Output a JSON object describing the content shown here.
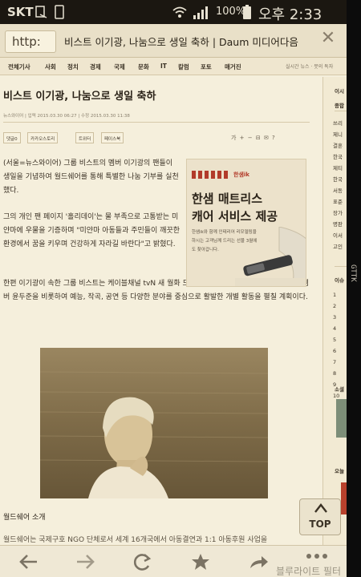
{
  "status_bar": {
    "carrier": "SKT",
    "battery_percent": "100%",
    "clock": "오후 2:33",
    "icons": [
      "wifi-icon",
      "signal-icon",
      "battery-icon",
      "sim-icon",
      "screenshot-icon"
    ]
  },
  "browser": {
    "url_text": "http:",
    "tab_title": "비스트 이기광, 나눔으로 생일 축하 | Daum 미디어다음",
    "close_icon": "close-icon"
  },
  "nav": {
    "items": [
      "전체기사",
      "사회",
      "정치",
      "경제",
      "국제",
      "문화",
      "IT",
      "칼럼",
      "포토",
      "매거진"
    ],
    "right_text": "실시간 뉴스 · 뭇의 독자"
  },
  "article": {
    "headline": "비스트 이기광, 나눔으로 생일 축하",
    "meta": "뉴스와이어  |  입력 2015.03.30 06:27  |  수정 2015.03.30 11:38",
    "share_buttons": [
      "댓글0",
      "카카오스토리",
      "트위터",
      "페이스북"
    ],
    "text_tools": "가 + − ⊟ ✉ ?",
    "paragraphs": [
      "(서울=뉴스와이어) 그룹 비스트의 멤버 이기광의 팬들이 생일을 기념하여 월드쉐어를 통해 특별한 나눔 기부를 실천했다.",
      "그의 개인 팬 페이지 '홀리데이'는 물 부족으로 고통받는 미얀마에 우물을 기증하며 \"미얀마 아동들과 주민들이 깨끗한 환경에서 꿈을 키우며 건강하게 자라길 바란다\"고 밝혔다.",
      "한편 이기광이 속한 그룹 비스트는 케이블채널 tvN 새 월화 드라마 '식샤를 합시다2' 촬영에 한창인 멤버 윤두준을 비롯하여 예능, 작곡, 공연 등 다양한 분야를 중심으로 활발한 개별 활동을 펼칠 계획이다."
    ],
    "caption": "월드쉐어 소개",
    "cut_text": "월드쉐어는 국제구호 NGO 단체로서 세계 16개국에서 아동결연과 1:1 아동후원 사업을"
  },
  "ad": {
    "brand": "한샘ik",
    "headline_line1": "한샘 매트리스",
    "headline_line2": "캐어 서비스 제공",
    "body": "한샘ik와 함께 인테리어 리모델링을 하시는 고객님께 드리는 선물 3월에도 찾아갑니다."
  },
  "sidebar": {
    "items": [
      "이시",
      "종합",
      "쓰리",
      "제니",
      "결혼",
      "한국",
      "제티",
      "한국",
      "서동",
      "표준",
      "장가",
      "명판",
      "이서",
      "고인",
      "이슈",
      "1",
      "2",
      "3",
      "4",
      "5",
      "6",
      "7",
      "8",
      "9",
      "10",
      "소셜",
      "오늘"
    ]
  },
  "top_button": {
    "label": "TOP"
  },
  "bottom_bar": {
    "buttons": [
      "back-icon",
      "forward-icon",
      "refresh-icon",
      "bookmark-star-icon",
      "share-icon"
    ],
    "filter_label": "블루라이트 필터"
  },
  "side_watermark": "GTTK",
  "colors": {
    "status_bar": "#1b1711",
    "page_background": "#f5efdc",
    "ad_accent": "#b23b2a"
  }
}
